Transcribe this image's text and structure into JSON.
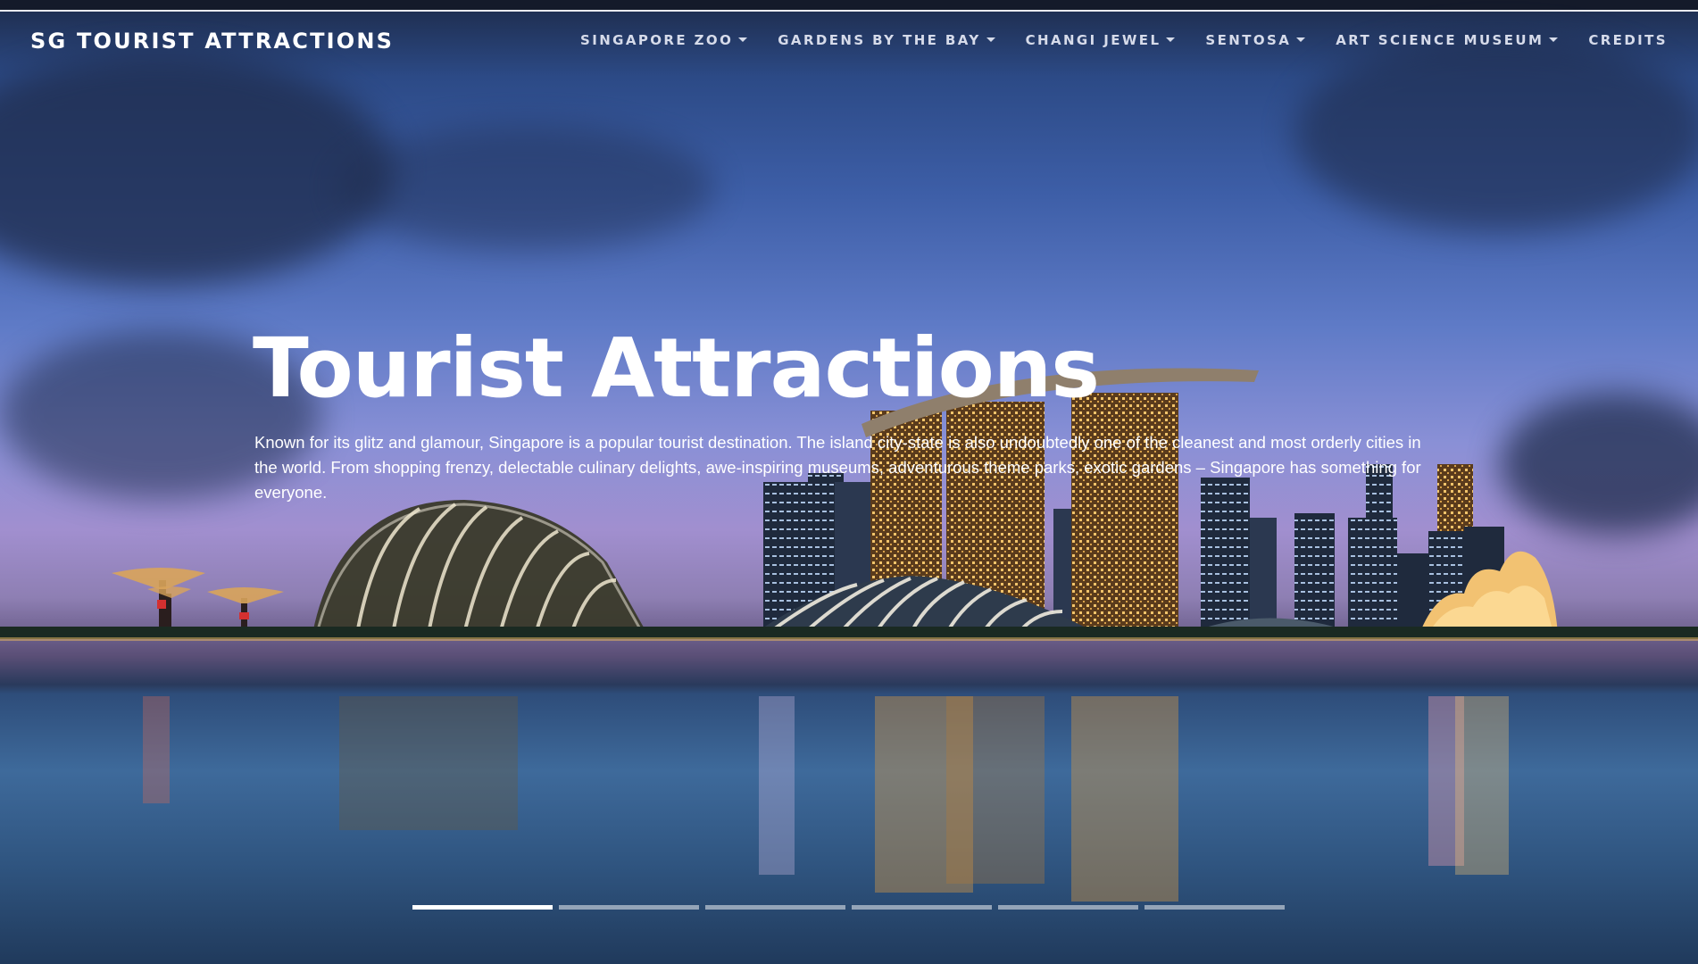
{
  "brand": "SG TOURIST ATTRACTIONS",
  "nav": {
    "items": [
      {
        "label": "SINGAPORE ZOO",
        "dropdown": true
      },
      {
        "label": "GARDENS BY THE BAY",
        "dropdown": true
      },
      {
        "label": "CHANGI JEWEL",
        "dropdown": true
      },
      {
        "label": "SENTOSA",
        "dropdown": true
      },
      {
        "label": "ART SCIENCE MUSEUM",
        "dropdown": true
      },
      {
        "label": "CREDITS",
        "dropdown": false
      }
    ]
  },
  "hero": {
    "title": "Tourist Attractions",
    "text": "Known for its glitz and glamour, Singapore is a popular tourist destination. The island city-state is also undoubtedly one of the cleanest and most orderly cities in the world. From shopping frenzy, delectable culinary delights, awe-inspiring museums, adventurous theme parks, exotic gardens – Singapore has something for everyone."
  },
  "carousel": {
    "slide_count": 6,
    "active_index": 0
  },
  "colors": {
    "text": "#ffffff",
    "nav_text": "#d6dbea",
    "sky_top": "#2c4a86",
    "sky_dusk": "#a18fcf",
    "water": "#3e6a9b"
  }
}
